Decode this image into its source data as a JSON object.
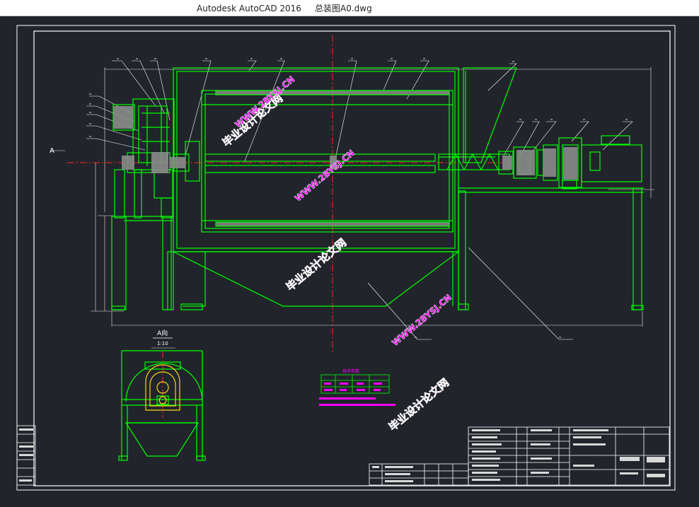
{
  "window": {
    "app_title": "Autodesk AutoCAD 2016",
    "file_name": "总装图A0.dwg"
  },
  "drawing": {
    "section_marker": "A",
    "view_label": "A向",
    "view_scale": "1:10",
    "table_title": "技术参数"
  },
  "watermark": {
    "line1": "毕业设计论文网",
    "line2": "WWW.2BYSJ.CN"
  },
  "colors": {
    "background": "#21252b",
    "frame": "#ffffff",
    "geometry": "#00ff00",
    "centerline": "#ff2020",
    "dimension": "#f0f0f0",
    "watermark": "#ff00ff"
  }
}
